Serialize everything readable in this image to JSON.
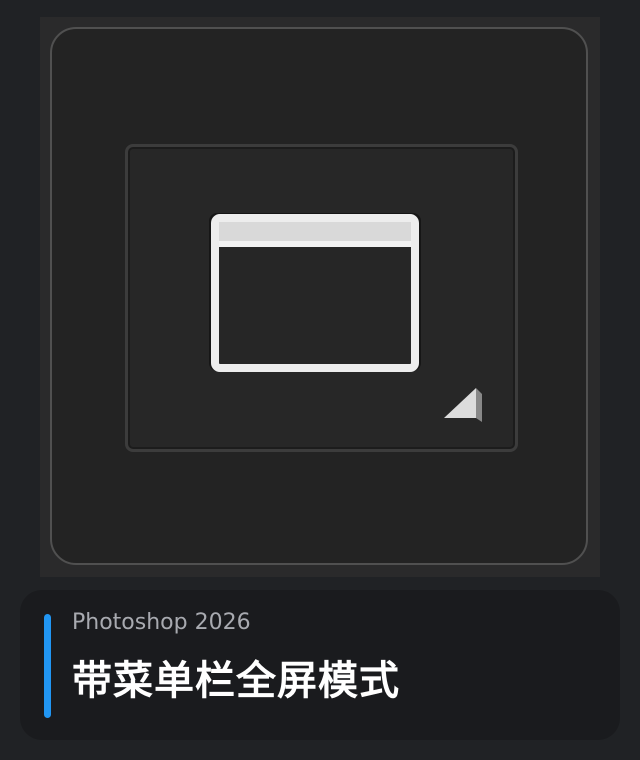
{
  "app": {
    "version_label": "Photoshop 2026"
  },
  "mode": {
    "title": "带菜单栏全屏模式",
    "icon": "full-screen-with-menu-icon"
  },
  "colors": {
    "accent": "#2196f3",
    "background": "#202225",
    "panel": "#1a1b1e"
  }
}
